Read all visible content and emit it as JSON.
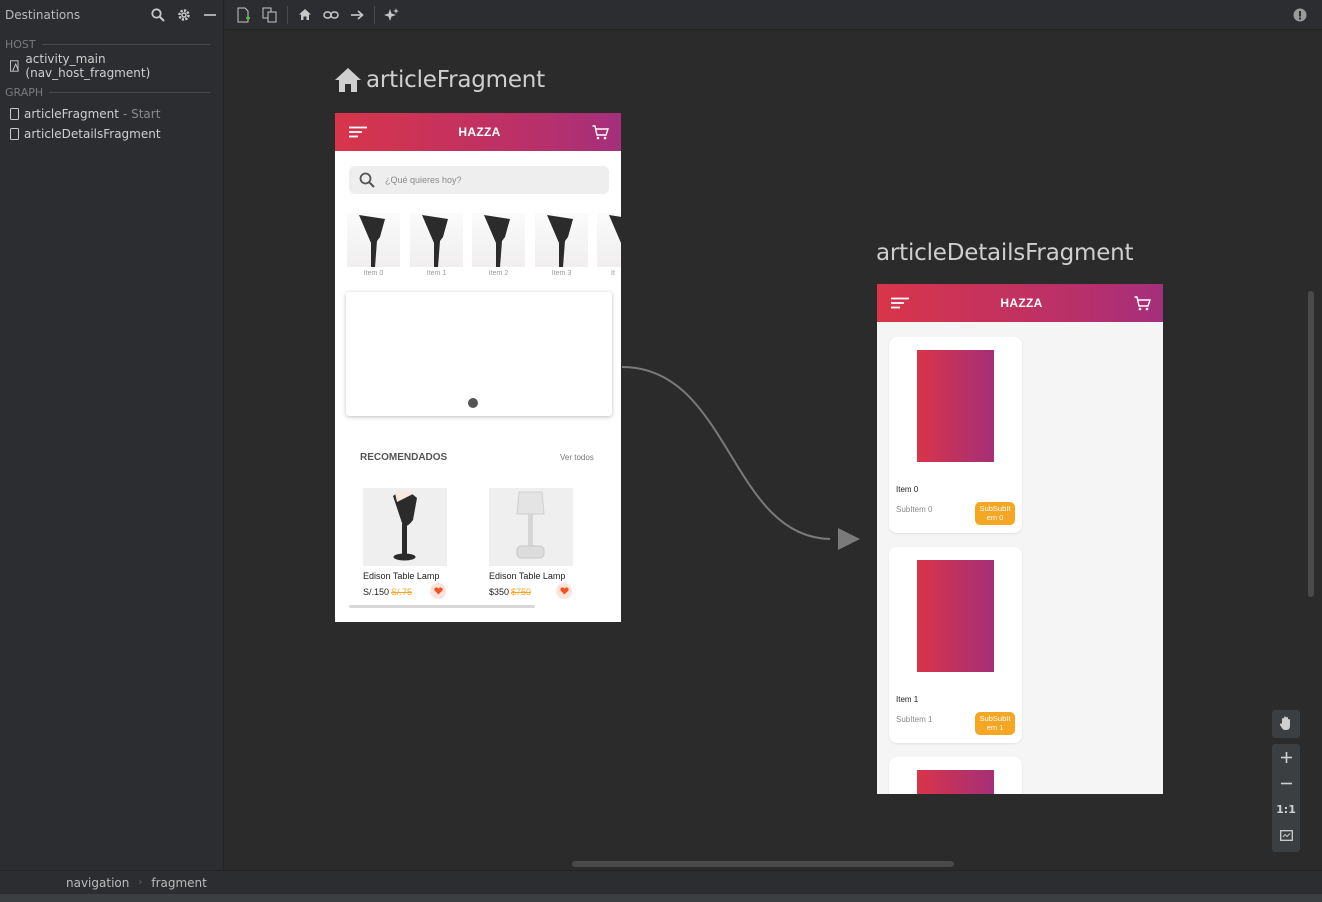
{
  "left_panel": {
    "title": "Destinations",
    "host_label": "HOST",
    "host_item": "activity_main (nav_host_fragment)",
    "graph_label": "GRAPH",
    "graph_items": [
      {
        "label": "articleFragment",
        "suffix": "- Start"
      },
      {
        "label": "articleDetailsFragment",
        "suffix": ""
      }
    ]
  },
  "canvas": {
    "fragment1": {
      "title": "articleFragment",
      "brand": "HAZZA",
      "search_placeholder": "¿Qué quieres hoy?",
      "thumbs": [
        "Item 0",
        "Item 1",
        "Item 2",
        "Item 3",
        "It"
      ],
      "rec_title": "RECOMENDADOS",
      "rec_more": "Ver todos",
      "products": [
        {
          "name": "Edison Table Lamp",
          "price": "S/.150",
          "old_price": "S/.75"
        },
        {
          "name": "Edison Table Lamp",
          "price": "$350",
          "old_price": "$750"
        }
      ]
    },
    "fragment2": {
      "title": "articleDetailsFragment",
      "brand": "HAZZA",
      "cards": [
        {
          "title": "Item 0",
          "subtitle": "SubItem 0",
          "badge": "SubSubIt em 0"
        },
        {
          "title": "Item 1",
          "subtitle": "SubItem 1",
          "badge": "SubSubIt em 1"
        }
      ]
    },
    "zoom": {
      "fit_label": "1:1"
    }
  },
  "breadcrumb": [
    "navigation",
    "fragment"
  ],
  "colors": {
    "accent_start": "#d8354a",
    "accent_end": "#a42f7c",
    "badge": "#f5a623"
  }
}
